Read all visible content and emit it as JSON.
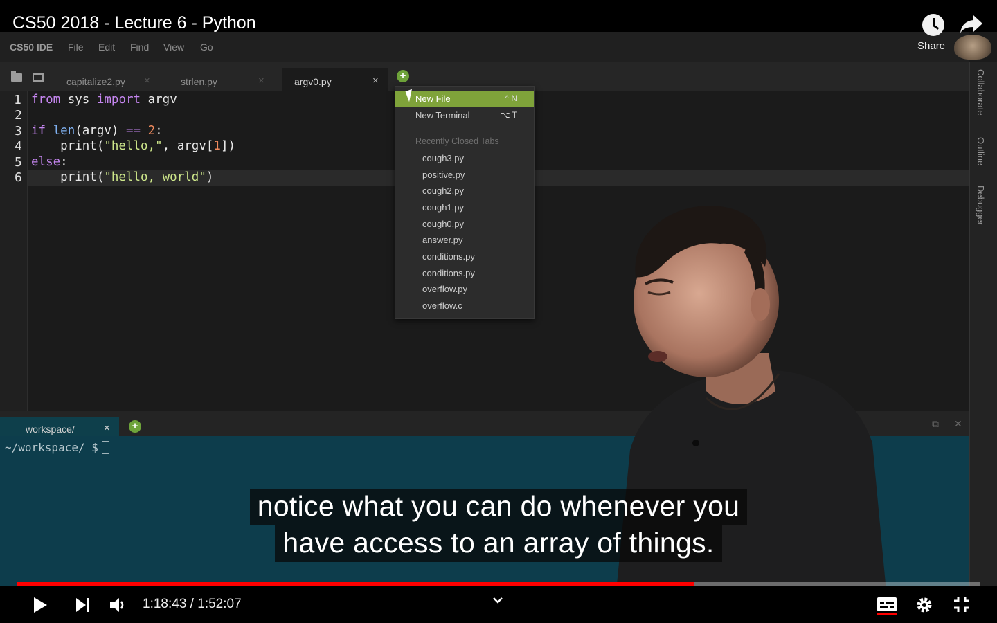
{
  "video": {
    "title": "CS50 2018 - Lecture 6 - Python",
    "share_label": "Share",
    "time_current": "1:18:43",
    "time_separator": " / ",
    "time_total": "1:52:07",
    "progress": 0.7026,
    "caption_lines": [
      "notice what you can do whenever you",
      "have access to an array of things."
    ]
  },
  "ide": {
    "brand": "CS50 IDE",
    "menu": [
      "File",
      "Edit",
      "Find",
      "View",
      "Go"
    ],
    "tabs": [
      {
        "label": "capitalize2.py",
        "close": "×"
      },
      {
        "label": "strlen.py",
        "close": "×"
      },
      {
        "label": "argv0.py",
        "close": "×"
      }
    ],
    "line_numbers": [
      "1",
      "2",
      "3",
      "4",
      "5",
      "6"
    ],
    "right_rail": [
      "Collaborate",
      "Outline",
      "Debugger"
    ],
    "dropdown": {
      "items": [
        {
          "label": "New File",
          "key": "^ N"
        },
        {
          "label": "New Terminal",
          "key": "⌥ T"
        }
      ],
      "section": "Recently Closed Tabs",
      "recent": [
        "cough3.py",
        "positive.py",
        "cough2.py",
        "cough1.py",
        "cough0.py",
        "answer.py",
        "conditions.py",
        "conditions.py",
        "overflow.py",
        "overflow.c"
      ]
    },
    "terminal": {
      "tab_label": "workspace/",
      "tab_close": "×",
      "prompt": "~/workspace/ $"
    }
  },
  "colors": {
    "accent_green": "#7fa33a",
    "progress_red": "#ff0000",
    "terminal_bg": "#0d3d4c"
  }
}
